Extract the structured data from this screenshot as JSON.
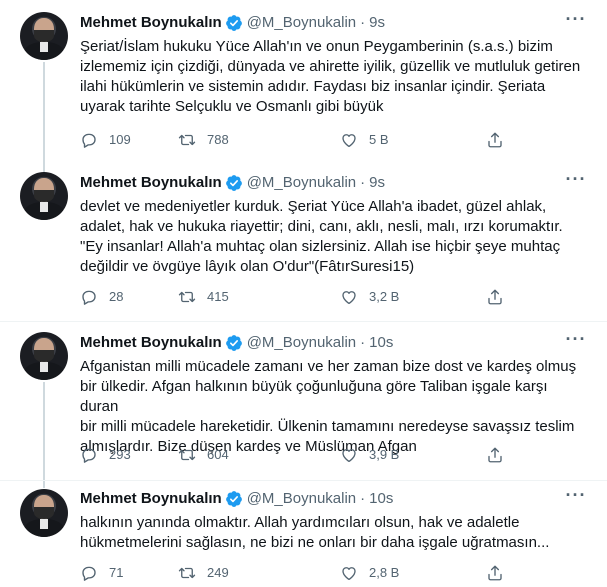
{
  "tweets": [
    {
      "author_name": "Mehmet Boynukalın",
      "handle": "@M_Boynukalin",
      "separator": "·",
      "time": "9s",
      "more": "···",
      "text": "Şeriat/İslam hukuku Yüce Allah'ın ve onun Peygamberinin (s.a.s.) bizim\nizlememiz için çizdiği, dünyada ve ahirette iyilik, güzellik ve mutluluk getiren\nilahi hükümlerin ve sistemin adıdır. Faydası biz insanlar içindir. Şeriata\nuyarak tarihte Selçuklu ve Osmanlı gibi büyük",
      "replies": "109",
      "retweets": "788",
      "likes": "5 B"
    },
    {
      "author_name": "Mehmet Boynukalın",
      "handle": "@M_Boynukalin",
      "separator": "·",
      "time": "9s",
      "more": "···",
      "text": "devlet ve medeniyetler kurduk. Şeriat Yüce Allah'a ibadet, güzel ahlak,\nadalet, hak ve hukuka riayettir; dini, canı, aklı, nesli, malı, ırzı korumaktır.\n\"Ey insanlar! Allah'a muhtaç olan sizlersiniz. Allah ise hiçbir şeye muhtaç\ndeğildir ve övgüye lâyık olan O'dur\"(FâtırSuresi15)",
      "replies": "28",
      "retweets": "415",
      "likes": "3,2 B"
    },
    {
      "author_name": "Mehmet Boynukalın",
      "handle": "@M_Boynukalin",
      "separator": "·",
      "time": "10s",
      "more": "···",
      "text": "Afganistan milli mücadele zamanı ve her zaman bize dost ve kardeş olmuş\nbir ülkedir. Afgan halkının büyük çoğunluğuna göre Taliban işgale karşı duran\nbir milli mücadele hareketidir. Ülkenin tamamını neredeyse savaşsız teslim\nalmışlardır. Bize düşen kardeş ve Müslüman Afgan",
      "replies": "293",
      "retweets": "604",
      "likes": "3,9 B"
    },
    {
      "author_name": "Mehmet Boynukalın",
      "handle": "@M_Boynukalin",
      "separator": "·",
      "time": "10s",
      "more": "···",
      "text": "halkının yanında  olmaktır. Allah yardımcıları olsun, hak ve adaletle\nhükmetmelerini sağlasın, ne bizi ne onları bir daha işgale uğratmasın...",
      "replies": "71",
      "retweets": "249",
      "likes": "2,8 B"
    }
  ],
  "icons": {
    "verified": "verified-badge-icon",
    "reply": "reply-icon",
    "retweet": "retweet-icon",
    "like": "like-icon",
    "share": "share-icon",
    "more": "more-icon"
  },
  "colors": {
    "verified_blue": "#1d9bf0",
    "muted_text": "#536471",
    "body_text": "#0f1419",
    "thread_line": "#cfd9de"
  }
}
